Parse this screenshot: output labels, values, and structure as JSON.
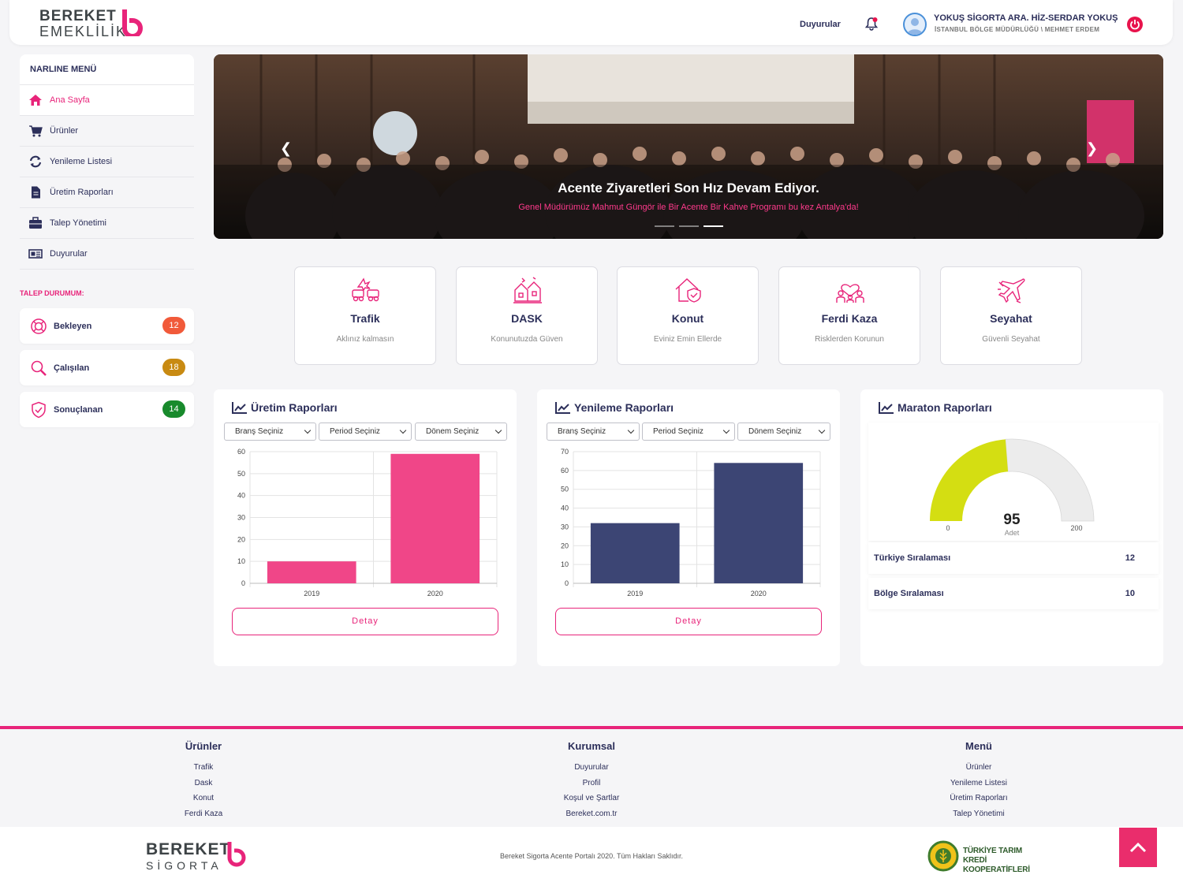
{
  "header": {
    "logo_top": "BEREKET",
    "logo_bottom": "EMEKLİLİK",
    "announcements": "Duyurular",
    "user_name": "YOKUŞ SİGORTA ARA. HİZ-SERDAR YOKUŞ",
    "user_sub": "İSTANBUL BÖLGE MÜDÜRLÜĞÜ \\ MEHMET ERDEM",
    "icons": [
      "bell-icon",
      "avatar",
      "power-icon"
    ]
  },
  "sidebar": {
    "title": "NARLINE MENÜ",
    "items": [
      {
        "label": "Ana Sayfa",
        "icon": "home-icon"
      },
      {
        "label": "Ürünler",
        "icon": "cart-icon"
      },
      {
        "label": "Yenileme Listesi",
        "icon": "refresh-icon"
      },
      {
        "label": "Üretim Raporları",
        "icon": "document-icon"
      },
      {
        "label": "Talep Yönetimi",
        "icon": "briefcase-icon"
      },
      {
        "label": "Duyurular",
        "icon": "newspaper-icon"
      }
    ],
    "talep_title": "TALEP DURUMUM:",
    "talep": [
      {
        "label": "Bekleyen",
        "count": "12",
        "color": "#f15a3a"
      },
      {
        "label": "Çalışılan",
        "count": "18",
        "color": "#c88a12"
      },
      {
        "label": "Sonuçlanan",
        "count": "14",
        "color": "#188a2c"
      }
    ]
  },
  "carousel": {
    "title": "Acente Ziyaretleri Son Hız Devam Ediyor.",
    "subtitle": "Genel Müdürümüz Mahmut Güngör ile Bir Acente Bir Kahve Programı bu kez Antalya'da!",
    "slide_count": 3,
    "active_slide": 3
  },
  "products": [
    {
      "title": "Trafik",
      "sub": "Aklınız kalmasın",
      "icon": "traffic-accident-icon"
    },
    {
      "title": "DASK",
      "sub": "Konunutuzda Güven",
      "icon": "earthquake-house-icon"
    },
    {
      "title": "Konut",
      "sub": "Eviniz Emin Ellerde",
      "icon": "home-shield-icon"
    },
    {
      "title": "Ferdi Kaza",
      "sub": "Risklerden Korunun",
      "icon": "family-icon"
    },
    {
      "title": "Seyahat",
      "sub": "Güvenli Seyahat",
      "icon": "airplane-icon"
    }
  ],
  "reports": {
    "uretim": {
      "title": "Üretim Raporları",
      "selects": [
        "Branş Seçiniz",
        "Period Seçiniz",
        "Dönem Seçiniz"
      ],
      "detail": "Detay"
    },
    "yenileme": {
      "title": "Yenileme Raporları",
      "selects": [
        "Branş Seçiniz",
        "Period Seçiniz",
        "Dönem Seçiniz"
      ],
      "detail": "Detay"
    },
    "maraton": {
      "title": "Maraton Raporları",
      "value": "95",
      "unit": "Adet",
      "min": "0",
      "max": "200",
      "fill_fraction": 0.475,
      "rank_tr_label": "Türkiye Sıralaması",
      "rank_tr": "12",
      "rank_bolge_label": "Bölge Sıralaması",
      "rank_bolge": "10"
    }
  },
  "chart_data": [
    {
      "type": "bar",
      "categories": [
        "2019",
        "2020"
      ],
      "values": [
        10,
        59
      ],
      "ylim": [
        0,
        60
      ],
      "yticks": [
        0,
        10,
        20,
        30,
        40,
        50,
        60
      ],
      "color": "#f04688",
      "grid": true
    },
    {
      "type": "bar",
      "categories": [
        "2019",
        "2020"
      ],
      "values": [
        32,
        64
      ],
      "ylim": [
        0,
        70
      ],
      "yticks": [
        0,
        10,
        20,
        30,
        40,
        50,
        60,
        70
      ],
      "color": "#3c4574",
      "grid": true
    }
  ],
  "footer": {
    "cols": [
      {
        "title": "Ürünler",
        "links": [
          "Trafik",
          "Dask",
          "Konut",
          "Ferdi Kaza"
        ]
      },
      {
        "title": "Kurumsal",
        "links": [
          "Duyurular",
          "Profil",
          "Koşul ve Şartlar",
          "Bereket.com.tr"
        ]
      },
      {
        "title": "Menü",
        "links": [
          "Ürünler",
          "Yenileme Listesi",
          "Üretim Raporları",
          "Talep Yönetimi"
        ]
      }
    ],
    "logo_top": "BEREKET",
    "logo_bottom": "SİGORTA",
    "copyright": "Bereket Sigorta Acente Portalı 2020. Tüm Hakları Saklıdır.",
    "partner_line1": "TÜRKİYE TARIM",
    "partner_line2": "KREDİ KOOPERATİFLERİ"
  },
  "colors": {
    "accent": "#e8247a",
    "navy": "#2c2f5a",
    "gauge": "#d4de12"
  }
}
